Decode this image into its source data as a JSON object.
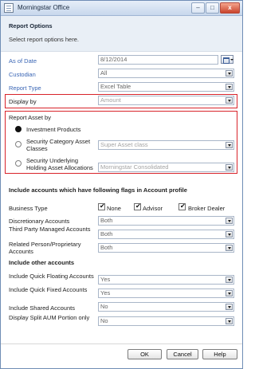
{
  "window": {
    "title": "Morningstar Office",
    "min": "–",
    "max": "□",
    "close": "x"
  },
  "header": {
    "title": "Report Options",
    "subtitle": "Select report options here."
  },
  "fields": {
    "as_of_date": {
      "label": "As of Date",
      "value": "8/12/2014"
    },
    "custodian": {
      "label": "Custodian",
      "value": "All"
    },
    "report_type": {
      "label": "Report Type",
      "value": "Excel Table"
    },
    "display_by": {
      "label": "Display by",
      "value": "Amount"
    }
  },
  "report_asset": {
    "title": "Report Asset by",
    "options": [
      {
        "label": "Investment Products",
        "selected": true
      },
      {
        "label": "Security Category Asset Classes",
        "value": "Super Asset class"
      },
      {
        "label": "Security Underlying Holding Asset Allocations",
        "value": "Morningstar Consolidated"
      }
    ]
  },
  "flags": {
    "title": "Include accounts which have following flags in Account profile",
    "business_type": {
      "label": "Business Type",
      "options": [
        {
          "label": "None",
          "checked": true
        },
        {
          "label": "Advisor",
          "checked": true
        },
        {
          "label": "Broker Dealer",
          "checked": true
        }
      ]
    },
    "discretionary": {
      "label": "Discretionary Accounts",
      "value": "Both"
    },
    "third_party": {
      "label": "Third Party Managed Accounts",
      "value": "Both"
    },
    "related_person": {
      "label": "Related Person/Proprietary Accounts",
      "value": "Both"
    }
  },
  "other": {
    "title": "Include other accounts",
    "quick_floating": {
      "label": "Include Quick Floating Accounts",
      "value": "Yes"
    },
    "quick_fixed": {
      "label": "Include Quick Fixed Accounts",
      "value": "Yes"
    },
    "shared": {
      "label": "Include Shared Accounts",
      "value": "No"
    },
    "split_aum": {
      "label": "Display Split AUM Portion only",
      "value": "No"
    }
  },
  "buttons": {
    "ok": "OK",
    "cancel": "Cancel",
    "help": "Help"
  }
}
